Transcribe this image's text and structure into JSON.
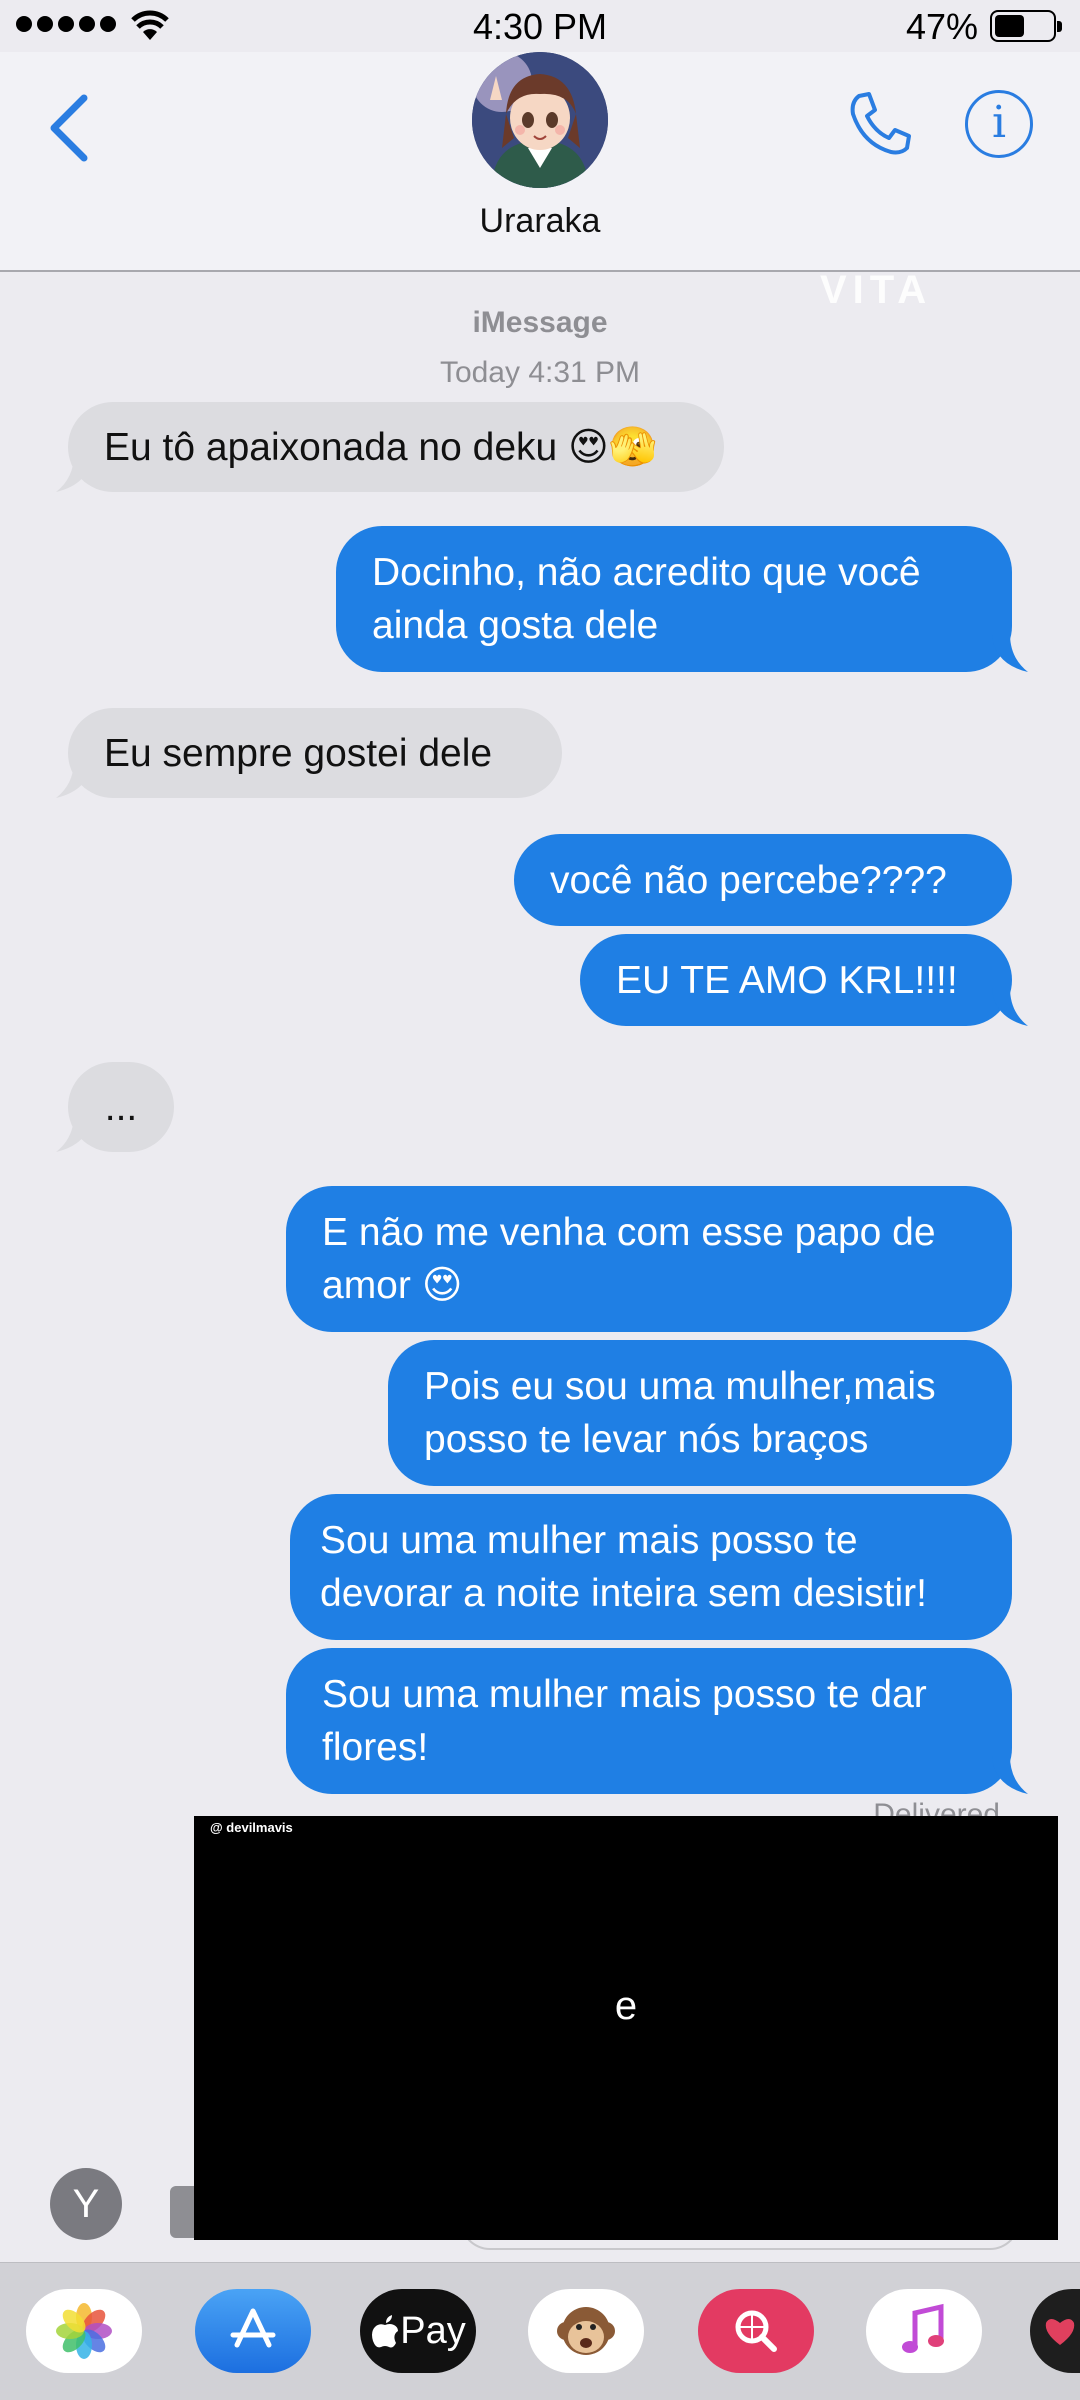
{
  "status_bar": {
    "time": "4:30 PM",
    "battery": "47%"
  },
  "header": {
    "contact_name": "Uraraka"
  },
  "watermark": "VITA",
  "thread": {
    "service": "iMessage",
    "timestamp": "Today 4:31 PM",
    "messages": [
      {
        "direction": "in",
        "text": "Eu tô apaixonada no deku 😍🫣"
      },
      {
        "direction": "out",
        "text": "Docinho, não acredito que você ainda gosta dele"
      },
      {
        "direction": "in",
        "text": "Eu sempre gostei dele"
      },
      {
        "direction": "out",
        "text": "você não percebe????"
      },
      {
        "direction": "out",
        "text": "EU TE AMO KRL!!!!"
      },
      {
        "direction": "in",
        "text": "..."
      },
      {
        "direction": "out",
        "text": "E não me venha com esse papo de amor 😍"
      },
      {
        "direction": "out",
        "text": "Pois eu sou uma mulher,mais posso te levar nós braços"
      },
      {
        "direction": "out",
        "text": "Sou uma mulher mais posso te devorar a noite inteira sem desistir!"
      },
      {
        "direction": "out",
        "text": "Sou uma mulher mais posso te dar flores!"
      }
    ],
    "delivered": "Delivered"
  },
  "overlay": {
    "handle": "@ devilmavis",
    "caption": "e"
  },
  "compose": {
    "avatar_letter": "Y"
  },
  "app_drawer": {
    "pay_label": " Pay",
    "apps": [
      "photos-icon",
      "app-store-icon",
      "apple-pay-icon",
      "animoji-icon",
      "image-search-icon",
      "music-icon",
      "heart-app-icon"
    ]
  },
  "colors": {
    "accent": "#1f7fe4",
    "incoming": "#dcdce0",
    "background": "#ecebf0"
  }
}
